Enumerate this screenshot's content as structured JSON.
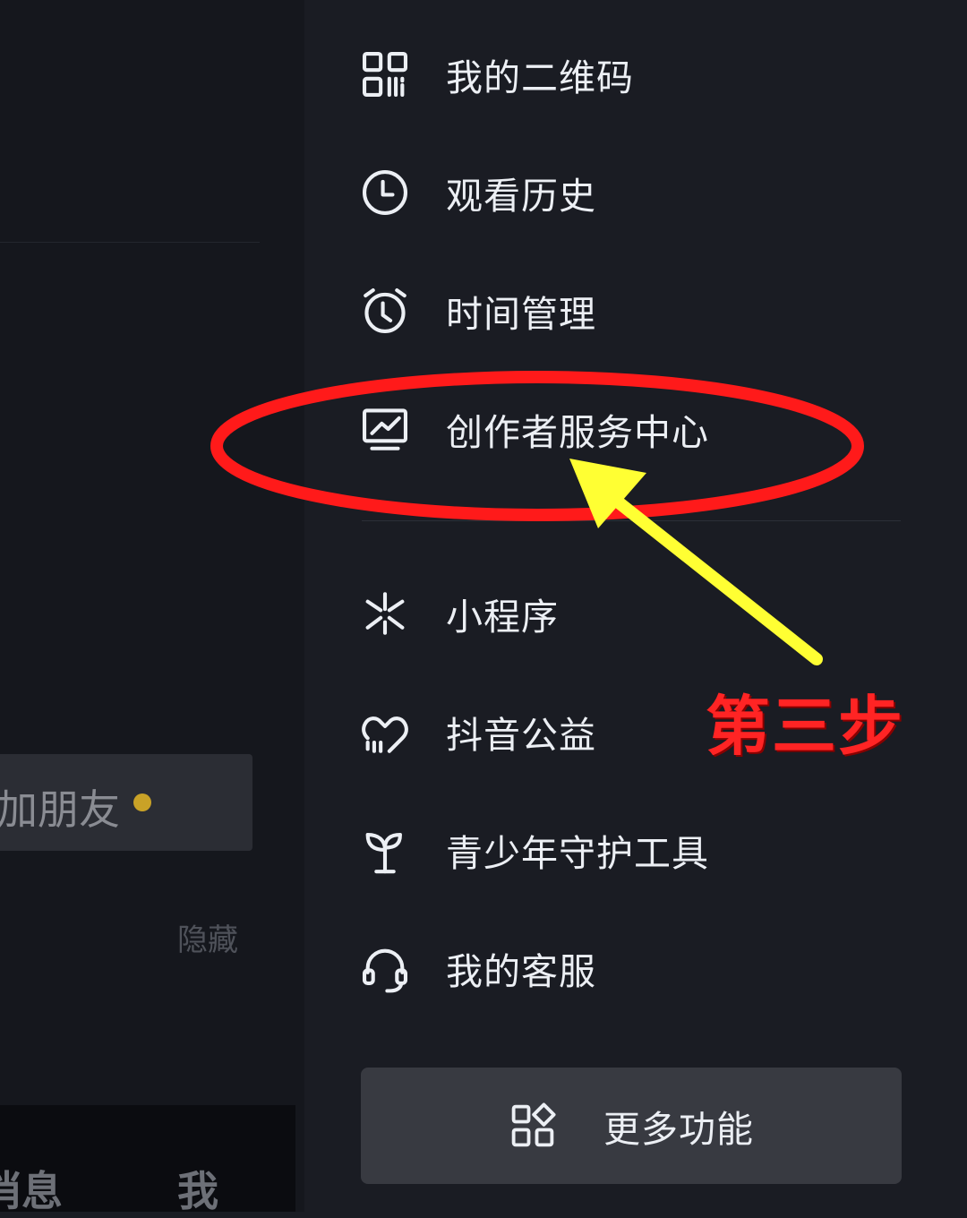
{
  "left_panel": {
    "add_friend_label": "加朋友",
    "hide_label": "隐藏",
    "bottom_tabs": {
      "messages": "消息",
      "me": "我"
    }
  },
  "drawer": {
    "items": [
      {
        "label": "我的二维码",
        "icon": "qr-code-icon"
      },
      {
        "label": "观看历史",
        "icon": "clock-icon"
      },
      {
        "label": "时间管理",
        "icon": "alarm-clock-icon"
      },
      {
        "label": "创作者服务中心",
        "icon": "creator-chart-icon"
      },
      {
        "label": "小程序",
        "icon": "mini-program-icon"
      },
      {
        "label": "抖音公益",
        "icon": "charity-heart-icon"
      },
      {
        "label": "青少年守护工具",
        "icon": "sprout-icon"
      },
      {
        "label": "我的客服",
        "icon": "headset-icon"
      }
    ],
    "more_button": {
      "label": "更多功能",
      "icon": "apps-grid-icon"
    }
  },
  "annotation": {
    "step_label": "第三步",
    "highlight_color": "#ff1a1a",
    "arrow_color": "#ffff33"
  },
  "colors": {
    "background": "#1a1c23",
    "text": "#eceff4",
    "notify_dot": "#c9a227"
  }
}
